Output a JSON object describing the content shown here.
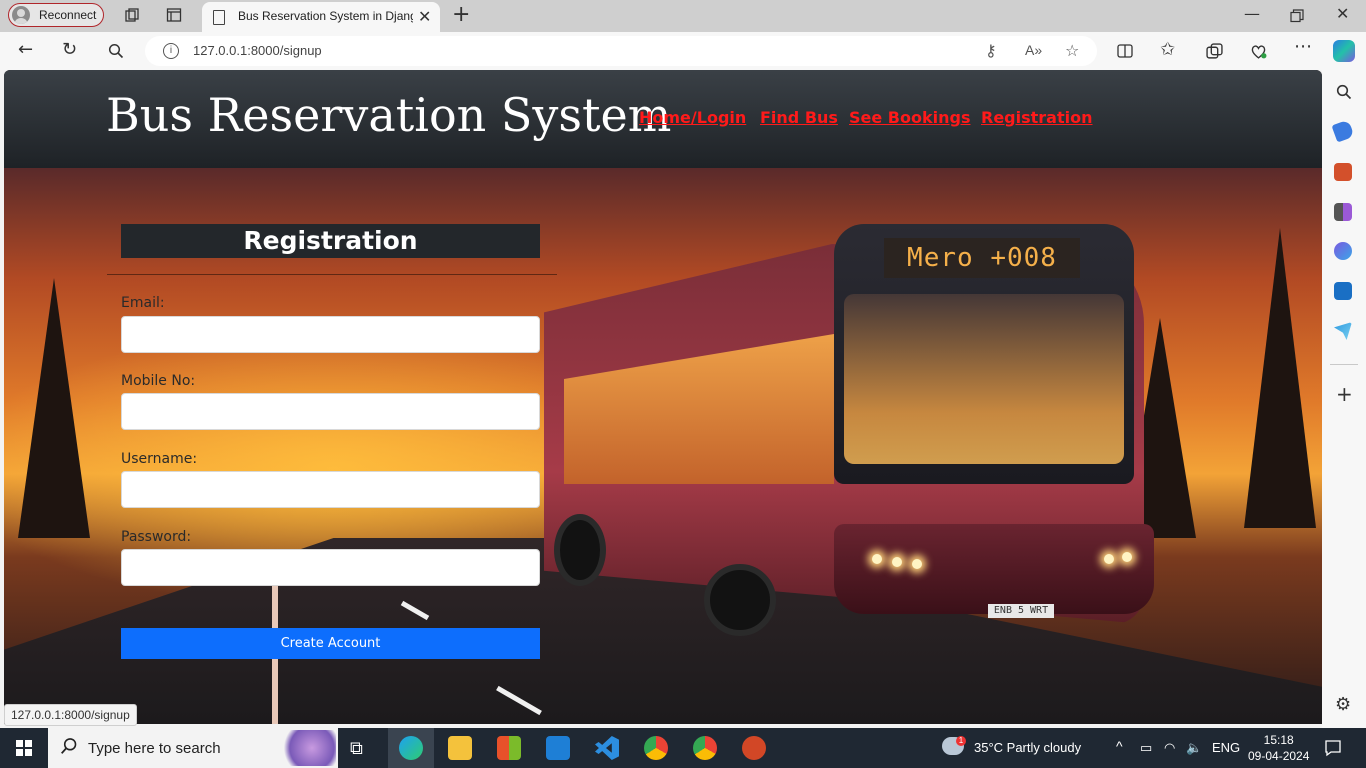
{
  "browser": {
    "reconnect_label": "Reconnect",
    "tab_title": "Bus Reservation System in Djang",
    "new_tab_glyph": "+",
    "url": "127.0.0.1:8000/signup",
    "status_url": "127.0.0.1:8000/signup"
  },
  "site": {
    "brand": "Bus Reservation System",
    "menu": [
      "Home/Login",
      "Find Bus",
      "See Bookings",
      "Registration"
    ],
    "accent_color": "#ff1a1a"
  },
  "hero": {
    "bus_sign": "Mero +008",
    "plate": "ENB 5 WRT"
  },
  "form": {
    "title": "Registration",
    "fields": [
      {
        "label": "Email:",
        "value": "",
        "placeholder": ""
      },
      {
        "label": "Mobile No:",
        "value": "",
        "placeholder": ""
      },
      {
        "label": "Username:",
        "value": "",
        "placeholder": ""
      },
      {
        "label": "Password:",
        "value": "",
        "placeholder": ""
      }
    ],
    "submit_label": "Create Account",
    "submit_color": "#0d6efd"
  },
  "taskbar": {
    "search_placeholder": "Type here to search",
    "weather_badge": "1",
    "weather": "35°C  Partly cloudy",
    "language": "ENG",
    "time": "15:18",
    "date": "09-04-2024"
  }
}
